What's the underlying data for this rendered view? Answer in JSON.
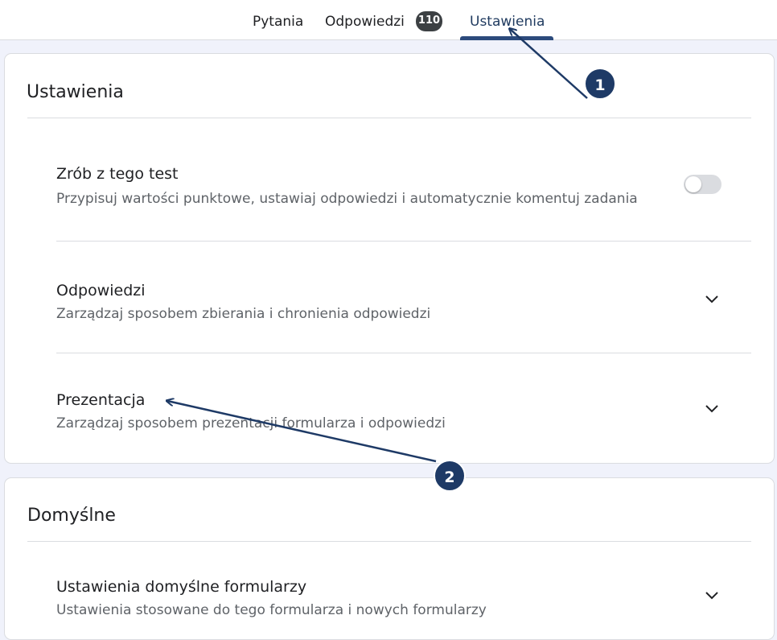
{
  "tabs": {
    "questions": "Pytania",
    "answers": "Odpowiedzi",
    "answers_count": "110",
    "settings": "Ustawienia"
  },
  "settings_card": {
    "title": "Ustawienia",
    "quiz": {
      "title": "Zrób z tego test",
      "desc": "Przypisuj wartości punktowe, ustawiaj odpowiedzi i automatycznie komentuj zadania",
      "toggle_on": false
    },
    "responses": {
      "title": "Odpowiedzi",
      "desc": "Zarządzaj sposobem zbierania i chronienia odpowiedzi"
    },
    "presentation": {
      "title": "Prezentacja",
      "desc": "Zarządzaj sposobem prezentacji formularza i odpowiedzi"
    }
  },
  "defaults_card": {
    "title": "Domyślne",
    "form_defaults": {
      "title": "Ustawienia domyślne formularzy",
      "desc": "Ustawienia stosowane do tego formularza i nowych formularzy"
    }
  },
  "callouts": [
    "1",
    "2"
  ],
  "colors": {
    "accent": "#1e3a66",
    "tab_underline": "#2c4a7c",
    "page_bg": "#f0f2fb"
  }
}
